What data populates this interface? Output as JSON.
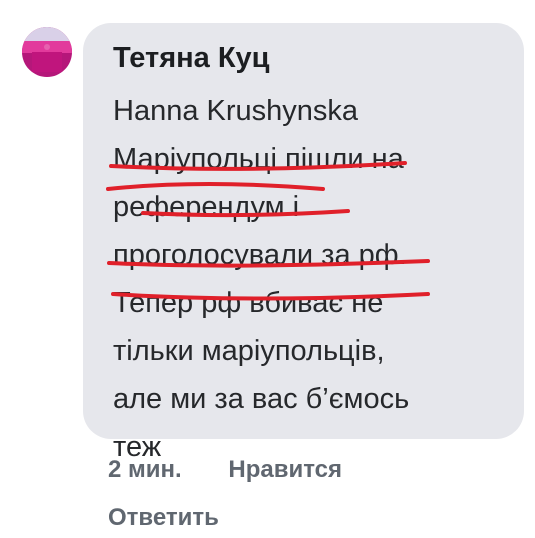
{
  "comment": {
    "author": "Тетяна Куц",
    "lines": [
      "Hanna Krushynska",
      "Маріупольці пішли на",
      "референдум і",
      "проголосували за рф.",
      "Тепер рф вбиває не",
      "тільки маріупольців,",
      "але ми за вас б’ємось",
      "теж"
    ]
  },
  "footer": {
    "time": "2 мин.",
    "like": "Нравится",
    "reply": "Ответить"
  },
  "colors": {
    "bubble": "#e6e7ec",
    "underline": "#e0202a",
    "meta": "#606770"
  }
}
